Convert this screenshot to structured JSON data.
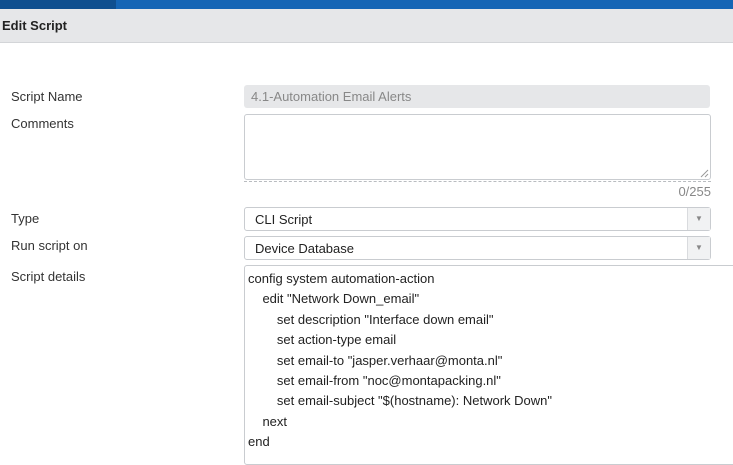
{
  "header": {
    "title": "Edit Script"
  },
  "form": {
    "script_name_label": "Script Name",
    "script_name_value": "4.1-Automation Email Alerts",
    "comments_label": "Comments",
    "comments_value": "",
    "comments_counter": "0/255",
    "type_label": "Type",
    "type_value": "CLI Script",
    "run_on_label": "Run script on",
    "run_on_value": "Device Database",
    "details_label": "Script details",
    "script_lines": [
      "config system automation-action",
      "    edit \"Network Down_email\"",
      "        set description \"Interface down email\"",
      "        set action-type email",
      "        set email-to \"jasper.verhaar@monta.nl\"",
      "        set email-from \"noc@montapacking.nl\"",
      "        set email-subject \"$(hostname): Network Down\"",
      "    next",
      "end"
    ]
  },
  "icons": {
    "dropdown": "chevron-down-icon",
    "resize": "resize-grip-icon"
  },
  "colors": {
    "topbar": "#1565b5",
    "topbar_active_tab": "#0f4f8f",
    "header_bg": "#e6e7e9"
  }
}
